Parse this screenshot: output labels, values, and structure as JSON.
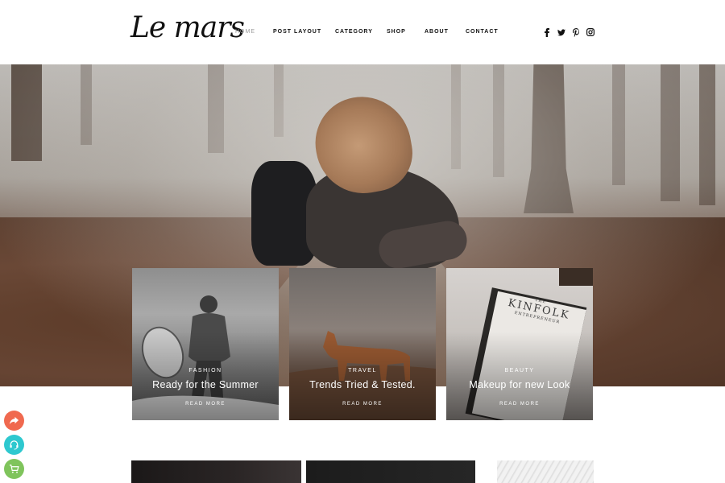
{
  "header": {
    "logo": "Le mars",
    "nav": [
      {
        "label": "HOME",
        "active": true
      },
      {
        "label": "POST LAYOUT",
        "active": false
      },
      {
        "label": "CATEGORY",
        "active": false
      },
      {
        "label": "SHOP",
        "active": false
      },
      {
        "label": "ABOUT",
        "active": false
      },
      {
        "label": "CONTACT",
        "active": false
      }
    ],
    "socials": [
      "facebook-icon",
      "twitter-icon",
      "pinterest-icon",
      "instagram-icon"
    ]
  },
  "cards": [
    {
      "category": "FASHION",
      "title": "Ready for the Summer",
      "read_more": "READ MORE"
    },
    {
      "category": "TRAVEL",
      "title": "Trends Tried & Tested.",
      "read_more": "READ MORE"
    },
    {
      "category": "BEAUTY",
      "title": "Makeup for new Look",
      "read_more": "READ MORE"
    }
  ],
  "book_cover": {
    "line1": "THE",
    "line2": "KINFOLK",
    "line3": "ENTREPRENEUR"
  },
  "fabs": [
    {
      "icon": "share-icon",
      "color": "#f0694f"
    },
    {
      "icon": "headset-icon",
      "color": "#2ec8cf"
    },
    {
      "icon": "cart-icon",
      "color": "#7fc45c"
    }
  ]
}
